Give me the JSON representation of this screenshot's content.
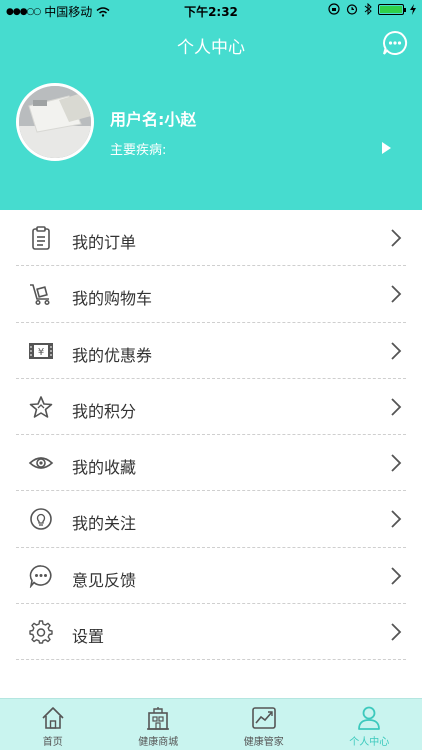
{
  "status_bar": {
    "carrier": "中国移动",
    "time": "下午2:32"
  },
  "navbar": {
    "title": "个人中心"
  },
  "profile": {
    "username": "用户名:小赵",
    "disease_label": "主要疾病:"
  },
  "menu": [
    {
      "label": "我的订单",
      "icon": "clipboard-icon"
    },
    {
      "label": "我的购物车",
      "icon": "cart-icon"
    },
    {
      "label": "我的优惠券",
      "icon": "coupon-icon"
    },
    {
      "label": "我的积分",
      "icon": "star-icon"
    },
    {
      "label": "我的收藏",
      "icon": "eye-icon"
    },
    {
      "label": "我的关注",
      "icon": "bulb-icon"
    },
    {
      "label": "意见反馈",
      "icon": "chat-icon"
    },
    {
      "label": "设置",
      "icon": "gear-icon"
    }
  ],
  "tabs": [
    {
      "label": "首页",
      "icon": "home-icon"
    },
    {
      "label": "健康商城",
      "icon": "store-icon"
    },
    {
      "label": "健康管家",
      "icon": "chart-icon"
    },
    {
      "label": "个人中心",
      "icon": "person-icon",
      "active": true
    }
  ],
  "colors": {
    "header": "#46dccf",
    "tabbar": "#c9f4ef",
    "active_tab": "#3cc9bd"
  }
}
